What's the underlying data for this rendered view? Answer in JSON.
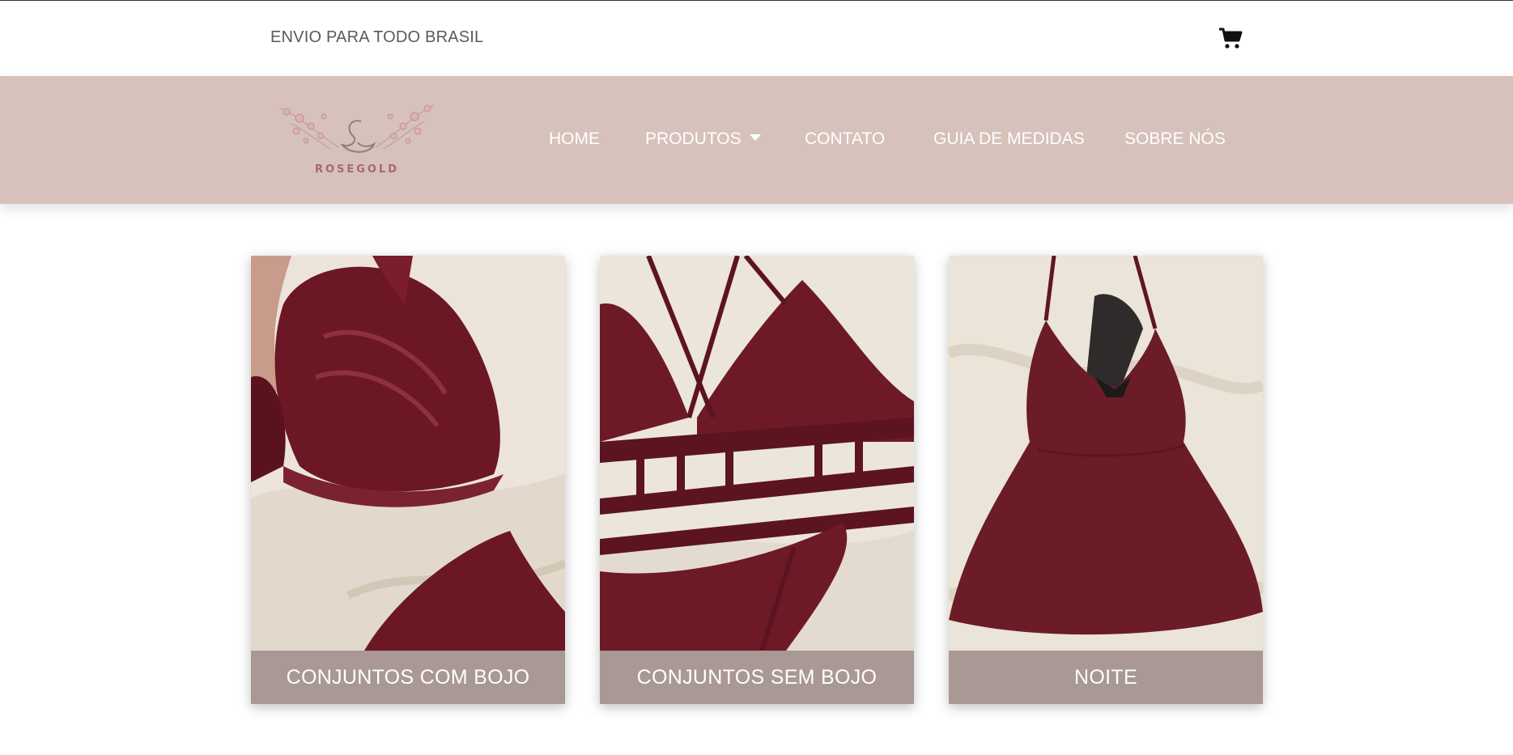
{
  "topbar": {
    "shipping_text": "ENVIO PARA TODO BRASIL",
    "cart_icon": "shopping-cart-icon"
  },
  "logo": {
    "brand": "ROSEGOLD",
    "icon": "swan-flowers-icon"
  },
  "nav": {
    "items": [
      {
        "label": "HOME"
      },
      {
        "label": "PRODUTOS",
        "icon": "caret-down-icon"
      },
      {
        "label": "CONTATO"
      },
      {
        "label": "GUIA DE MEDIDAS"
      },
      {
        "label": "SOBRE NÓS"
      }
    ]
  },
  "categories": [
    {
      "label": "CONJUNTOS COM BOJO",
      "image": "burgundy-lace-bra-photo"
    },
    {
      "label": "CONJUNTOS SEM BOJO",
      "image": "burgundy-strappy-bralette-photo"
    },
    {
      "label": "NOITE",
      "image": "burgundy-nightgown-photo"
    }
  ],
  "colors": {
    "nav_background": "#d6c1bb",
    "card_label_background": "#a99893",
    "brand": "#a9676b",
    "burgundy": "#6e1a26",
    "satin": "#efe9df"
  }
}
